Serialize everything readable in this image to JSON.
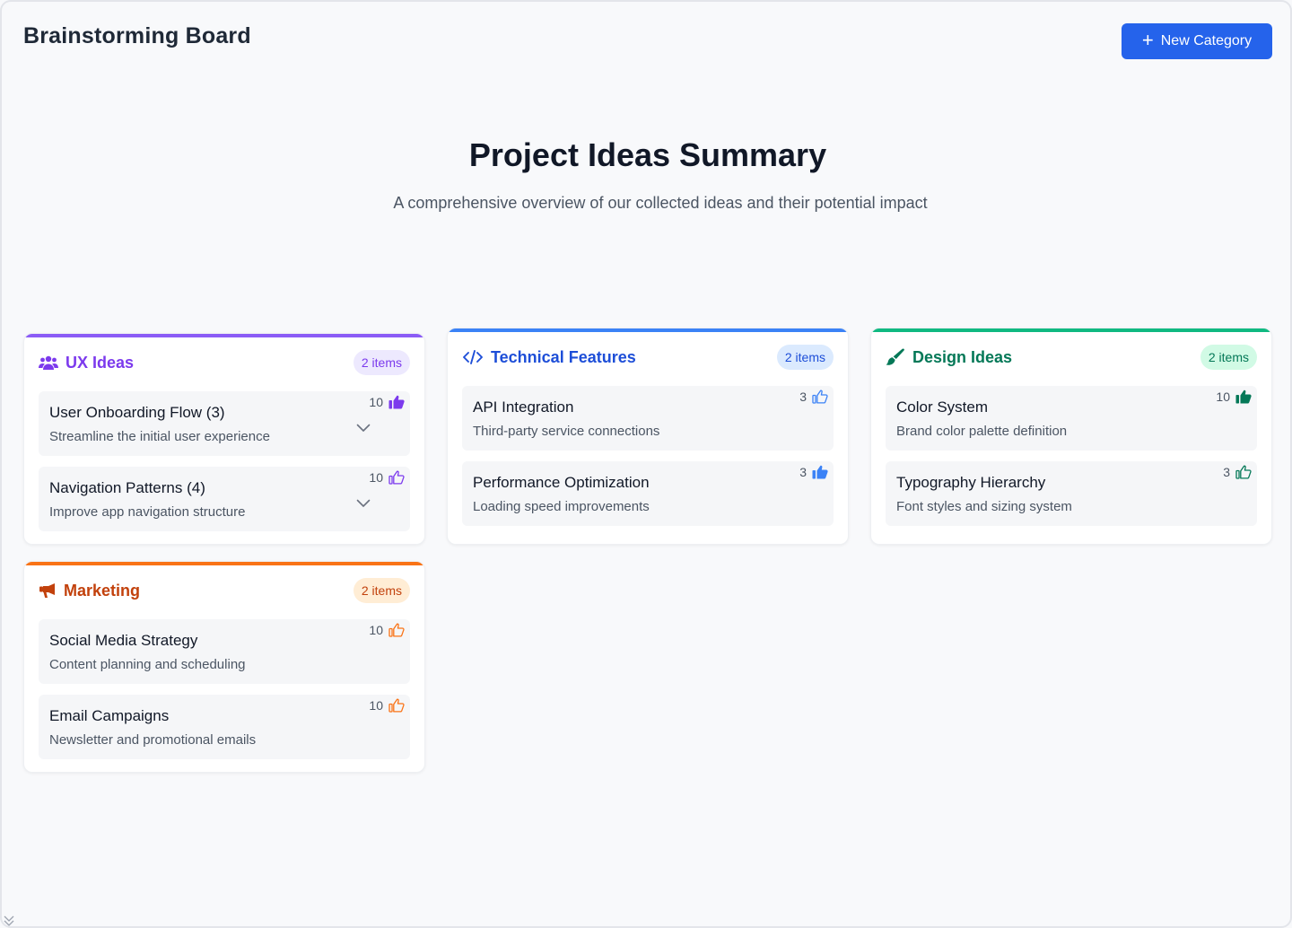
{
  "header": {
    "app_title": "Brainstorming Board",
    "new_category_label": "New Category"
  },
  "hero": {
    "title": "Project Ideas Summary",
    "subtitle": "A comprehensive overview of our collected ideas and their potential impact"
  },
  "colors": {
    "ux": "#7c3aed",
    "technical": "#1d4ed8",
    "design": "#047857",
    "marketing": "#c2410c",
    "primary_button": "#2563eb"
  },
  "categories": [
    {
      "key": "ux",
      "title": "UX Ideas",
      "icon": "users-icon",
      "badge": "2 items",
      "items": [
        {
          "name": "User Onboarding Flow (3)",
          "desc": "Streamline the initial user experience",
          "votes": "10",
          "liked": true,
          "expandable": true
        },
        {
          "name": "Navigation Patterns (4)",
          "desc": "Improve app navigation structure",
          "votes": "10",
          "liked": false,
          "expandable": true
        }
      ]
    },
    {
      "key": "technical",
      "title": "Technical Features",
      "icon": "code-icon",
      "badge": "2 items",
      "items": [
        {
          "name": "API Integration",
          "desc": "Third-party service connections",
          "votes": "3",
          "liked": false
        },
        {
          "name": "Performance Optimization",
          "desc": "Loading speed improvements",
          "votes": "3",
          "liked": true
        }
      ]
    },
    {
      "key": "design",
      "title": "Design Ideas",
      "icon": "paint-brush-icon",
      "badge": "2 items",
      "items": [
        {
          "name": "Color System",
          "desc": "Brand color palette definition",
          "votes": "10",
          "liked": true
        },
        {
          "name": "Typography Hierarchy",
          "desc": "Font styles and sizing system",
          "votes": "3",
          "liked": false
        }
      ]
    },
    {
      "key": "marketing",
      "title": "Marketing",
      "icon": "megaphone-icon",
      "badge": "2 items",
      "items": [
        {
          "name": "Social Media Strategy",
          "desc": "Content planning and scheduling",
          "votes": "10",
          "liked": false
        },
        {
          "name": "Email Campaigns",
          "desc": "Newsletter and promotional emails",
          "votes": "10",
          "liked": false
        }
      ]
    }
  ]
}
